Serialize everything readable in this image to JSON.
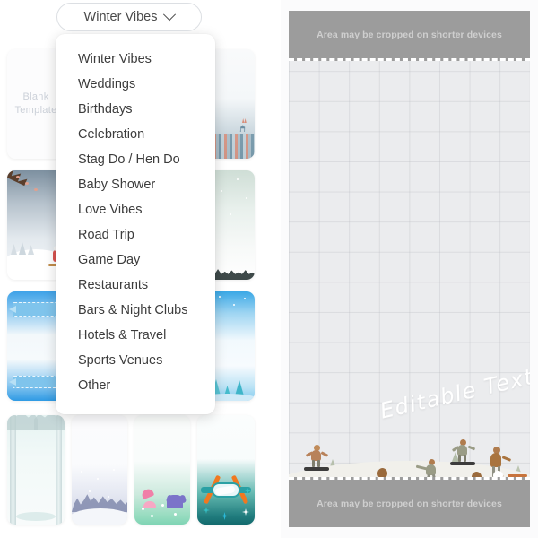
{
  "dropdown": {
    "selected_label": "Winter Vibes",
    "chevron_icon": "chevron-down-icon",
    "options": [
      "Winter Vibes",
      "Weddings",
      "Birthdays",
      "Celebration",
      "Stag Do / Hen Do",
      "Baby Shower",
      "Love Vibes",
      "Road Trip",
      "Game Day",
      "Restaurants",
      "Bars & Night Clubs",
      "Hotels & Travel",
      "Sports Venues",
      "Other"
    ]
  },
  "gallery": {
    "blank_template_label_line1": "Blank",
    "blank_template_label_line2": "Template",
    "thumbnails": [
      {
        "name": "blank-template",
        "theme": "blank"
      },
      {
        "name": "nordic-deer",
        "theme": "deer-pattern"
      },
      {
        "name": "snowy-branch-sled",
        "theme": "snow-hill"
      },
      {
        "name": "winter-forest-silhouette",
        "theme": "forest"
      },
      {
        "name": "blue-banner",
        "theme": "banner"
      },
      {
        "name": "blue-snow-trees",
        "theme": "blue-trees"
      },
      {
        "name": "frosted-arch",
        "theme": "arch"
      },
      {
        "name": "snow-village",
        "theme": "village"
      },
      {
        "name": "mittens-and-hat",
        "theme": "mittens"
      },
      {
        "name": "ski-goggles",
        "theme": "goggles"
      }
    ]
  },
  "preview": {
    "crop_warning_top": "Area may be cropped on shorter devices",
    "crop_warning_bottom": "Area may be cropped on shorter devices",
    "editable_text": "Editable Text!",
    "canvas_background": "#ebecee",
    "crop_band_color": "#9c9c9c",
    "scene_snow_color": "#f1f0eb",
    "scene_tree_color": "#b7c0ac",
    "figure_color": "#a9743f"
  }
}
